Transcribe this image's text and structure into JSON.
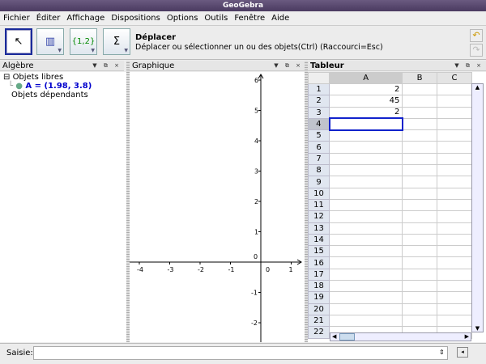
{
  "window": {
    "title": "GeoGebra"
  },
  "menu": [
    "Fichier",
    "Éditer",
    "Affichage",
    "Dispositions",
    "Options",
    "Outils",
    "Fenêtre",
    "Aide"
  ],
  "toolbar": {
    "tools": [
      {
        "name": "move",
        "label": ""
      },
      {
        "name": "chart",
        "label": ""
      },
      {
        "name": "list",
        "label": "{1,2}"
      },
      {
        "name": "sum",
        "label": "Σ"
      }
    ],
    "active_title": "Déplacer",
    "active_desc": "Déplacer ou sélectionner un ou des objets(Ctrl) (Raccourci=Esc)"
  },
  "algebra": {
    "title": "Algèbre",
    "free_label": "Objets libres",
    "point": "A = (1.98, 3.8)",
    "dependent_label": "Objets dépendants"
  },
  "graphics": {
    "title": "Graphique",
    "x_ticks": [
      "-4",
      "-3",
      "-2",
      "-1",
      "0",
      "1"
    ],
    "y_ticks": [
      "6",
      "5",
      "4",
      "3",
      "2",
      "1",
      "0",
      "-1",
      "-2"
    ]
  },
  "spreadsheet": {
    "title": "Tableur",
    "columns": [
      "A",
      "B",
      "C"
    ],
    "rows": [
      "1",
      "2",
      "3",
      "4",
      "5",
      "6",
      "7",
      "8",
      "9",
      "10",
      "11",
      "12",
      "13",
      "14",
      "15",
      "16",
      "17",
      "18",
      "19",
      "20",
      "21",
      "22"
    ],
    "values": {
      "1": "2",
      "2": "45",
      "3": "2"
    },
    "selected_row": "4"
  },
  "input": {
    "label": "Saisie:",
    "value": ""
  }
}
